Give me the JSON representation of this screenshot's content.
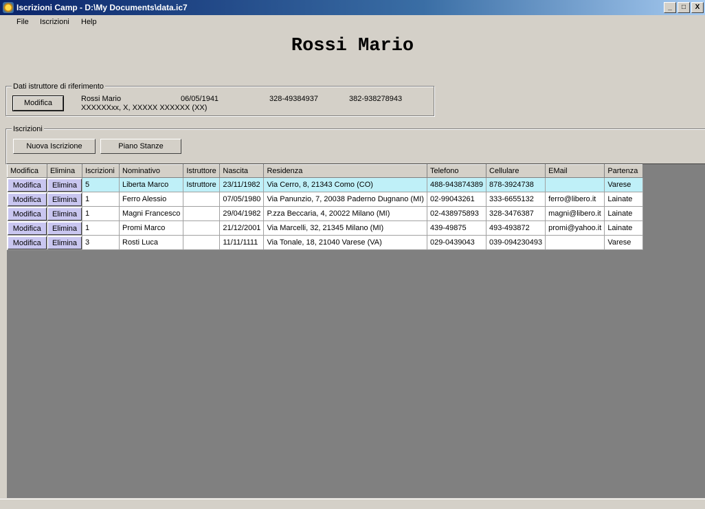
{
  "window": {
    "title": "Iscrizioni Camp - D:\\My Documents\\data.ic7",
    "minimize": "_",
    "maximize": "□",
    "close": "X"
  },
  "menu": [
    "File",
    "Iscrizioni",
    "Help"
  ],
  "header_name": "Rossi Mario",
  "istruttore": {
    "group_label": "Dati istruttore di riferimento",
    "button_label": "Modifica",
    "name": "Rossi Mario",
    "birth": "06/05/1941",
    "phone1": "328-49384937",
    "phone2": "382-938278943",
    "address": "XXXXXXxx, X, XXXXX XXXXXX (XX)"
  },
  "iscrizioni": {
    "group_label": "Iscrizioni",
    "new_button": "Nuova Iscrizione",
    "rooms_button": "Piano Stanze"
  },
  "table": {
    "columns": [
      "Modifica",
      "Elimina",
      "Iscrizioni",
      "Nominativo",
      "Istruttore",
      "Nascita",
      "Residenza",
      "Telefono",
      "Cellulare",
      "EMail",
      "Partenza"
    ],
    "edit_label": "Modifica",
    "delete_label": "Elimina",
    "rows": [
      {
        "iscrizioni": "5",
        "nominativo": "Liberta Marco",
        "istruttore": "Istruttore",
        "nascita": "23/11/1982",
        "residenza": "Via Cerro, 8, 21343 Como (CO)",
        "telefono": "488-943874389",
        "cellulare": "878-3924738",
        "email": "",
        "partenza": "Varese"
      },
      {
        "iscrizioni": "1",
        "nominativo": "Ferro Alessio",
        "istruttore": "",
        "nascita": "07/05/1980",
        "residenza": "Via Panunzio, 7, 20038 Paderno Dugnano (MI)",
        "telefono": "02-99043261",
        "cellulare": "333-6655132",
        "email": "ferro@libero.it",
        "partenza": "Lainate"
      },
      {
        "iscrizioni": "1",
        "nominativo": "Magni Francesco",
        "istruttore": "",
        "nascita": "29/04/1982",
        "residenza": "P.zza Beccaria, 4, 20022 Milano (MI)",
        "telefono": "02-438975893",
        "cellulare": "328-3476387",
        "email": "magni@libero.it",
        "partenza": "Lainate"
      },
      {
        "iscrizioni": "1",
        "nominativo": "Promi Marco",
        "istruttore": "",
        "nascita": "21/12/2001",
        "residenza": "Via Marcelli, 32, 21345 Milano (MI)",
        "telefono": "439-49875",
        "cellulare": "493-493872",
        "email": "promi@yahoo.it",
        "partenza": "Lainate"
      },
      {
        "iscrizioni": "3",
        "nominativo": "Rosti Luca",
        "istruttore": "",
        "nascita": "11/11/1111",
        "residenza": "Via Tonale, 18, 21040 Varese (VA)",
        "telefono": "029-0439043",
        "cellulare": "039-094230493",
        "email": "",
        "partenza": "Varese"
      }
    ]
  }
}
